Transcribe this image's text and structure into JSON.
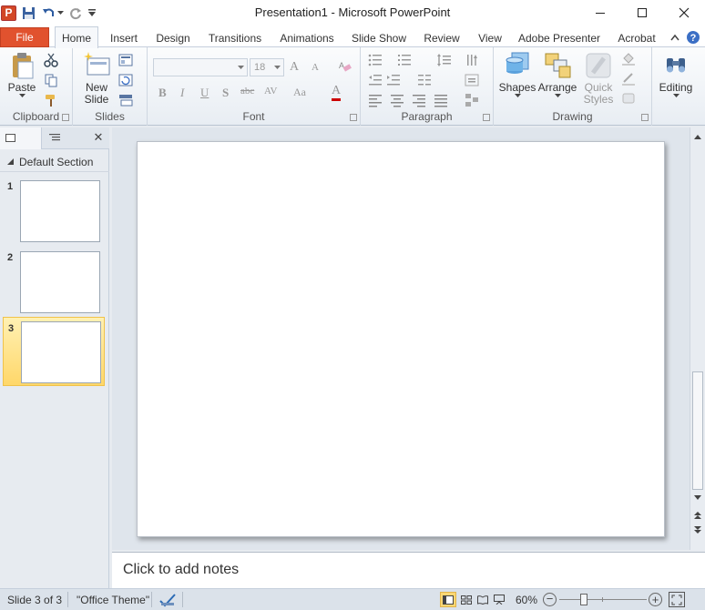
{
  "window": {
    "title": "Presentation1 - Microsoft PowerPoint",
    "app_icon_letter": "P",
    "minimize": "—",
    "maximize": "☐",
    "close": "✕"
  },
  "ribbon_tabs": [
    {
      "label": "File",
      "active": false
    },
    {
      "label": "Home",
      "active": true
    },
    {
      "label": "Insert",
      "active": false
    },
    {
      "label": "Design",
      "active": false
    },
    {
      "label": "Transitions",
      "active": false
    },
    {
      "label": "Animations",
      "active": false
    },
    {
      "label": "Slide Show",
      "active": false
    },
    {
      "label": "Review",
      "active": false
    },
    {
      "label": "View",
      "active": false
    },
    {
      "label": "Adobe Presenter",
      "active": false
    },
    {
      "label": "Acrobat",
      "active": false
    }
  ],
  "ribbon": {
    "clipboard": {
      "label": "Clipboard",
      "paste": "Paste"
    },
    "slides": {
      "label": "Slides",
      "new_slide_line1": "New",
      "new_slide_line2": "Slide"
    },
    "font": {
      "label": "Font",
      "size": "18",
      "bold": "B",
      "italic": "I",
      "underline": "U",
      "shadow": "S",
      "strike": "abc",
      "spacing": "AV",
      "case": "Aa",
      "color": "A",
      "grow": "A",
      "shrink": "A"
    },
    "paragraph": {
      "label": "Paragraph"
    },
    "drawing": {
      "label": "Drawing",
      "shapes": "Shapes",
      "arrange": "Arrange",
      "quick_styles_line1": "Quick",
      "quick_styles_line2": "Styles"
    },
    "editing": {
      "label": "Editing"
    }
  },
  "left_pane": {
    "section_name": "Default Section",
    "close": "✕",
    "slides": [
      {
        "number": "1",
        "selected": false
      },
      {
        "number": "2",
        "selected": false
      },
      {
        "number": "3",
        "selected": true
      }
    ]
  },
  "notes": {
    "placeholder": "Click to add notes"
  },
  "status_bar": {
    "slide_info": "Slide 3 of 3",
    "theme": "\"Office Theme\"",
    "zoom": "60%",
    "zoom_minus": "−",
    "zoom_plus": "+"
  },
  "colors": {
    "file_tab": "#e1522e",
    "selected_thumb": "#ffd76a",
    "app_icon": "#d24726"
  }
}
